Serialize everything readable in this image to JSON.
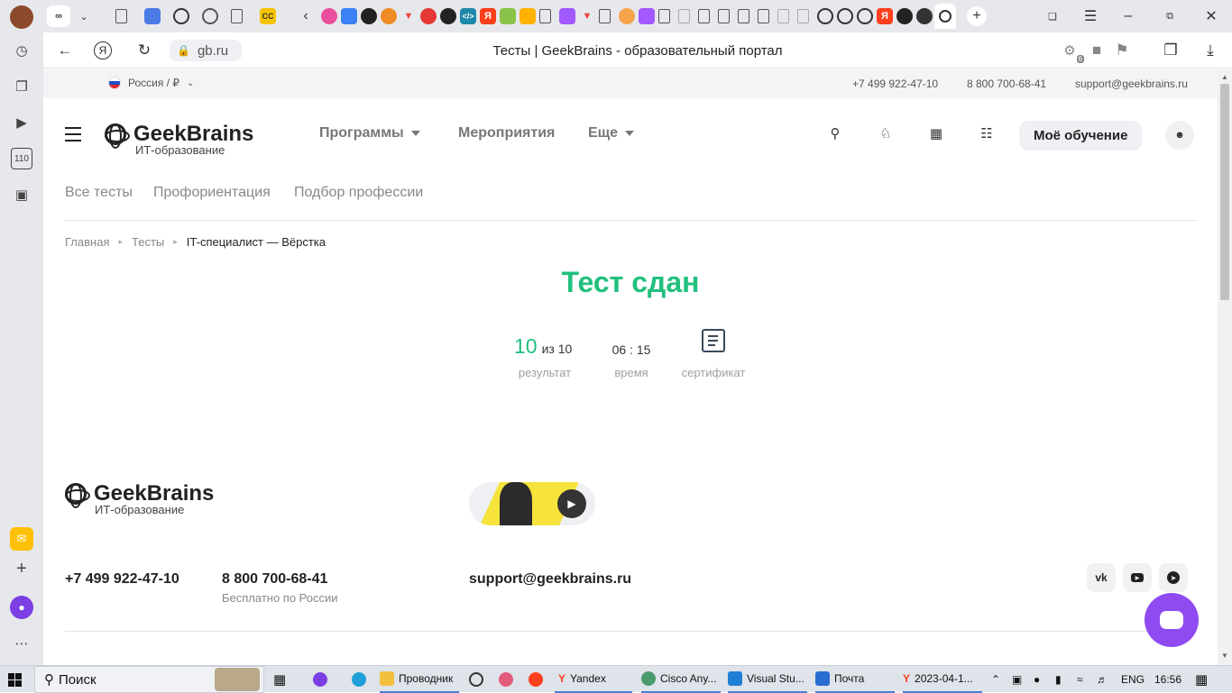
{
  "browser": {
    "tab_title": "Тесты | GeekBrains - образовательный портал",
    "url": "gb.ru",
    "sidebar_counter": "110",
    "extension_badge": "6",
    "tab_labels": [
      "∞",
      "CC",
      "Я",
      "Я"
    ]
  },
  "topstrip": {
    "region": "Россия / ₽",
    "phone1": "+7 499 922-47-10",
    "phone2": "8 800 700-68-41",
    "email": "support@geekbrains.ru"
  },
  "header": {
    "logo_name": "GeekBrains",
    "logo_tagline": "ИТ-образование",
    "nav": {
      "programs": "Программы",
      "events": "Мероприятия",
      "more": "Еще"
    },
    "my_learning": "Моё обучение"
  },
  "subnav": {
    "all_tests": "Все тесты",
    "career": "Профориентация",
    "profession": "Подбор профессии"
  },
  "breadcrumb": {
    "home": "Главная",
    "tests": "Тесты",
    "current": "IT-специалист — Вёрстка"
  },
  "result": {
    "title": "Тест сдан",
    "score": "10",
    "score_of": "из 10",
    "score_label": "результат",
    "time": "06 : 15",
    "time_label": "время",
    "certificate_label": "сертификат"
  },
  "footer": {
    "logo_name": "GeekBrains",
    "logo_tagline": "ИТ-образование",
    "phone1": "+7 499 922-47-10",
    "phone2": "8 800 700-68-41",
    "phone2_note": "Бесплатно по России",
    "email": "support@geekbrains.ru",
    "social": [
      "vk-icon",
      "youtube-icon",
      "telegram-icon"
    ]
  },
  "taskbar": {
    "search": "Поиск",
    "apps": [
      {
        "label": "Проводник"
      },
      {
        "label": "Yandex"
      },
      {
        "label": "Cisco Any..."
      },
      {
        "label": "Visual Stu..."
      },
      {
        "label": "Почта"
      },
      {
        "label": "2023-04-1..."
      }
    ],
    "lang": "ENG",
    "clock": "16:56"
  },
  "colors": {
    "accent_green": "#21c07e",
    "chat_purple": "#8f4bf1",
    "brand_dark": "#2c2c2c"
  }
}
